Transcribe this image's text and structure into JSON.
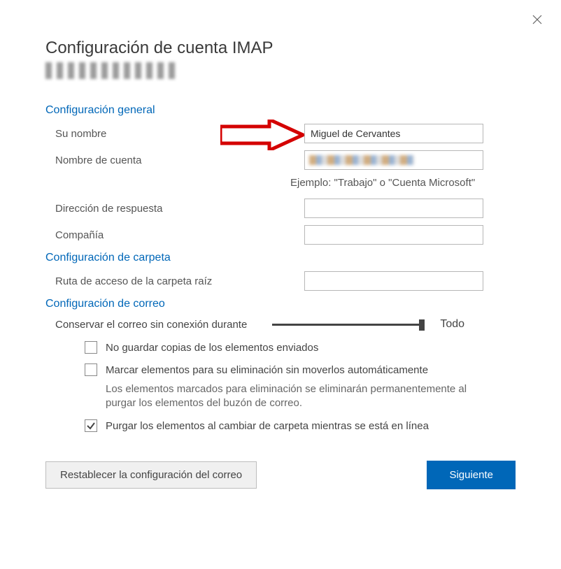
{
  "title": "Configuración de cuenta IMAP",
  "sections": {
    "general": {
      "title": "Configuración general",
      "name_label": "Su nombre",
      "name_value": "Miguel de Cervantes",
      "account_label": "Nombre de cuenta",
      "account_hint": "Ejemplo: \"Trabajo\" o \"Cuenta Microsoft\"",
      "reply_label": "Dirección de respuesta",
      "reply_value": "",
      "company_label": "Compañía",
      "company_value": ""
    },
    "folder": {
      "title": "Configuración de carpeta",
      "root_label": "Ruta de acceso de la carpeta raíz",
      "root_value": ""
    },
    "mail": {
      "title": "Configuración de correo",
      "offline_label": "Conservar el correo sin conexión durante",
      "offline_value": "Todo",
      "check_no_save": "No guardar copias de los elementos enviados",
      "check_no_save_checked": false,
      "check_mark_delete": "Marcar elementos para su eliminación sin moverlos automáticamente",
      "check_mark_delete_checked": false,
      "mark_delete_note": "Los elementos marcados para eliminación se eliminarán permanentemente al purgar los elementos del buzón de correo.",
      "check_purge": "Purgar los elementos al cambiar de carpeta mientras se está en línea",
      "check_purge_checked": true
    }
  },
  "footer": {
    "reset": "Restablecer la configuración del correo",
    "next": "Siguiente"
  }
}
